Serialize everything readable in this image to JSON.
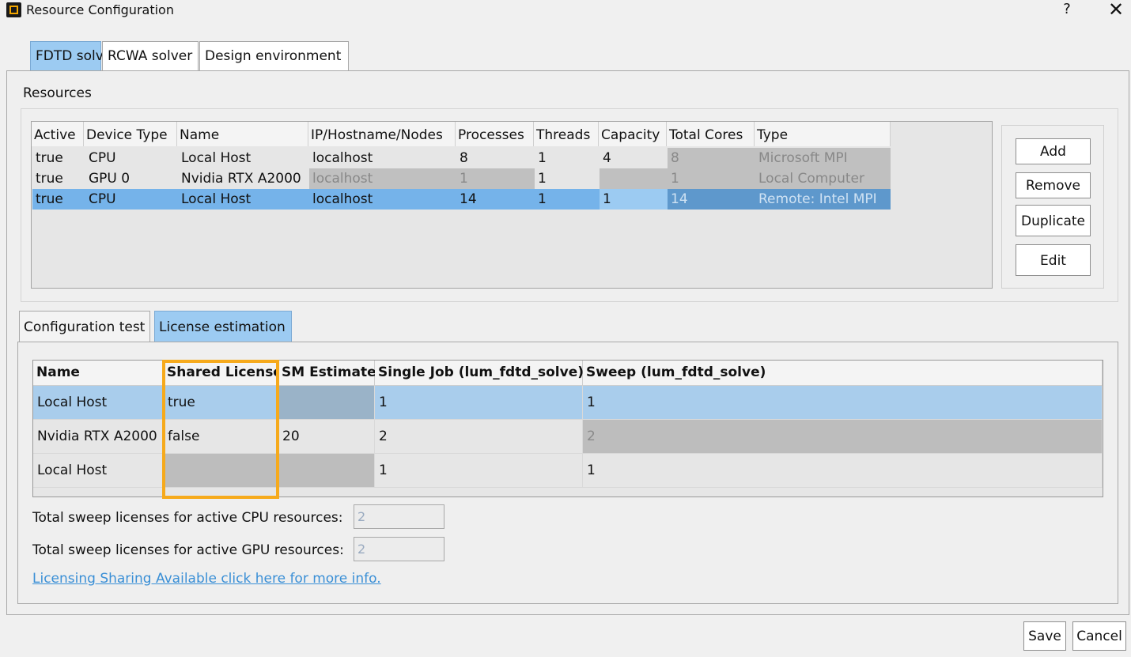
{
  "window": {
    "title": "Resource Configuration",
    "help": "?",
    "close": "✕"
  },
  "tabs": [
    "FDTD solver",
    "RCWA solver",
    "Design environment"
  ],
  "resources": {
    "section_title": "Resources",
    "columns": [
      "Active",
      "Device Type",
      "Name",
      "IP/Hostname/Nodes",
      "Processes",
      "Threads",
      "Capacity",
      "Total Cores",
      "Type"
    ],
    "rows": [
      [
        "true",
        "CPU",
        "Local Host",
        "localhost",
        "8",
        "1",
        "4",
        "8",
        "Microsoft MPI"
      ],
      [
        "true",
        "GPU 0",
        "Nvidia RTX A2000",
        "localhost",
        "1",
        "1",
        "",
        "1",
        "Local Computer"
      ],
      [
        "true",
        "CPU",
        "Local Host",
        "localhost",
        "14",
        "1",
        "1",
        "14",
        "Remote: Intel MPI"
      ]
    ],
    "buttons": [
      "Add",
      "Remove",
      "Duplicate",
      "Edit"
    ]
  },
  "subtabs": [
    "Configuration test",
    "License estimation"
  ],
  "license": {
    "columns": [
      "Name",
      "Shared License",
      "SM Estimate",
      "Single Job (lum_fdtd_solve)",
      "Sweep (lum_fdtd_solve)"
    ],
    "rows": [
      [
        "Local Host",
        "true",
        "",
        "1",
        "1"
      ],
      [
        "Nvidia RTX A2000",
        "false",
        "20",
        "2",
        "2"
      ],
      [
        "Local Host",
        "",
        "",
        "1",
        "1"
      ]
    ]
  },
  "summary": {
    "cpu_label": "Total sweep licenses for active CPU resources:",
    "cpu_value": "2",
    "gpu_label": "Total sweep licenses for active GPU resources:",
    "gpu_value": "2",
    "link": "Licensing Sharing Available click here for more info."
  },
  "footer": {
    "save": "Save",
    "cancel": "Cancel"
  }
}
